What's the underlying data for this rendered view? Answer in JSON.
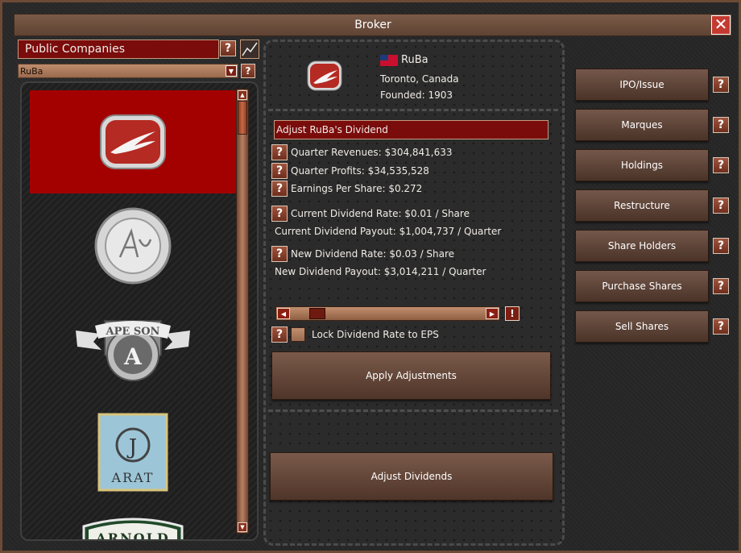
{
  "window": {
    "title": "Broker",
    "close_icon": "close-icon"
  },
  "left": {
    "header": "Public Companies",
    "selected_company": "RuBa",
    "logos": [
      {
        "name": "RuBa",
        "selected": true
      },
      {
        "name": "AU"
      },
      {
        "name": "APE SON",
        "letter": "A"
      },
      {
        "name": "ARAT",
        "letter": "J"
      },
      {
        "name": "ARNOLD"
      }
    ]
  },
  "company": {
    "name": "RuBa",
    "location": "Toronto, Canada",
    "founded": "Founded: 1903"
  },
  "dividend": {
    "title": "Adjust RuBa's Dividend",
    "quarter_revenues": "Quarter Revenues: $304,841,633",
    "quarter_profits": "Quarter Profits: $34,535,528",
    "eps": "Earnings Per Share: $0.272",
    "current_rate": "Current Dividend Rate: $0.01 / Share",
    "current_payout": "Current Dividend Payout: $1,004,737 / Quarter",
    "new_rate": "New Dividend Rate: $0.03 / Share",
    "new_payout": "New Dividend Payout: $3,014,211 / Quarter",
    "slider_level": 0.1,
    "lock_label": "Lock Dividend Rate to EPS",
    "apply_label": "Apply Adjustments",
    "adjust_label": "Adjust Dividends"
  },
  "side_buttons": [
    "IPO/Issue",
    "Marques",
    "Holdings",
    "Restructure",
    "Share Holders",
    "Purchase Shares",
    "Sell Shares"
  ],
  "help_glyph": "?",
  "warn_glyph": "!",
  "colors": {
    "accent_red": "#a30000",
    "title_brown": "#6d4a36",
    "button_brown": "#5a3e31"
  }
}
